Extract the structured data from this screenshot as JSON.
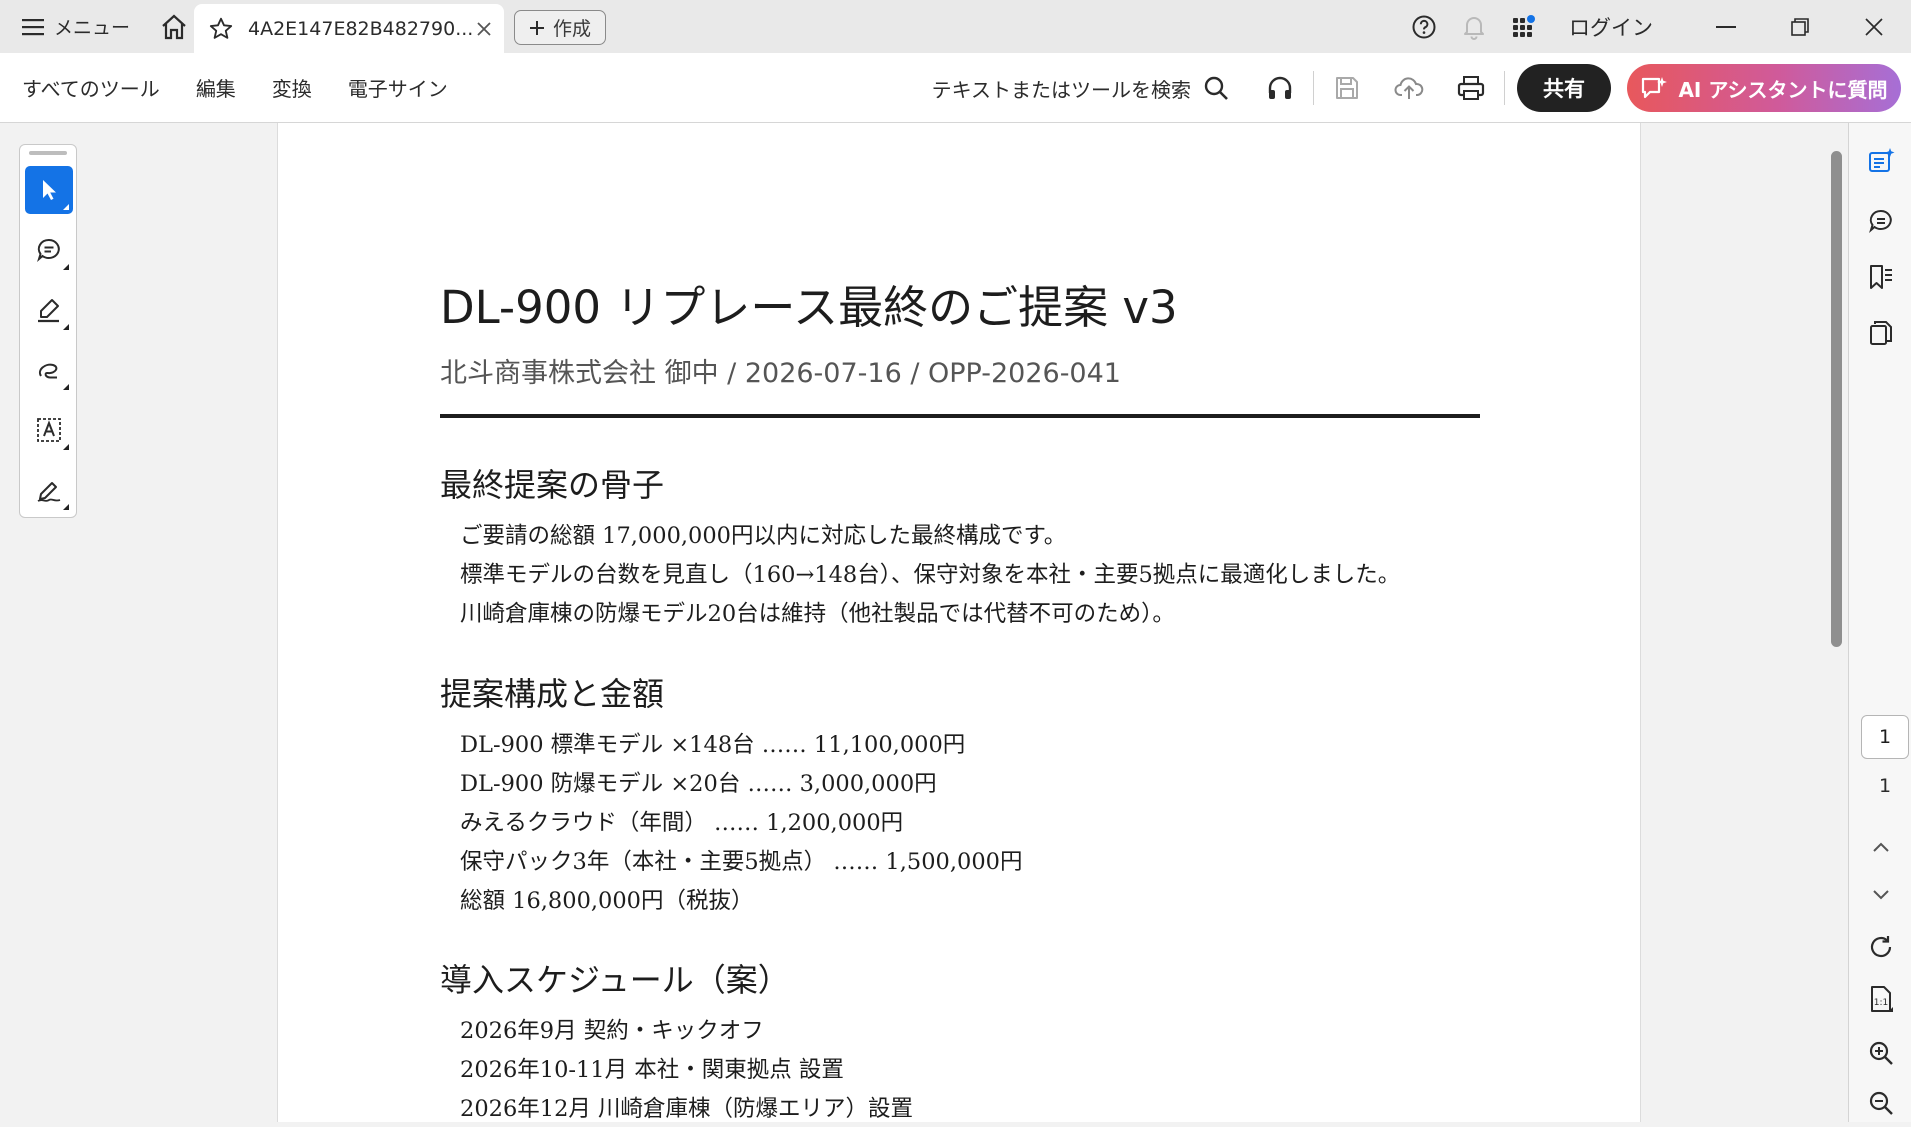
{
  "titlebar": {
    "menu_label": "メニュー",
    "tab_title": "4A2E147E82B482790...",
    "create_label": "作成",
    "login_label": "ログイン"
  },
  "toolbar": {
    "nav": [
      "すべてのツール",
      "編集",
      "変換",
      "電子サイン"
    ],
    "search_label": "テキストまたはツールを検索",
    "share_label": "共有",
    "ai_label": "AI アシスタントに質問"
  },
  "document": {
    "title": "DL-900 リプレース最終のご提案 v3",
    "subtitle": "北斗商事株式会社 御中 / 2026-07-16 / OPP-2026-041",
    "sections": [
      {
        "heading": "最終提案の骨子",
        "lines": [
          "ご要請の総額 17,000,000円以内に対応した最終構成です。",
          "標準モデルの台数を見直し（160→148台）、保守対象を本社・主要5拠点に最適化しました。",
          "川崎倉庫棟の防爆モデル20台は維持（他社製品では代替不可のため）。"
        ]
      },
      {
        "heading": "提案構成と金額",
        "lines": [
          "DL-900 標準モデル ×148台 …… 11,100,000円",
          "DL-900 防爆モデル ×20台 …… 3,000,000円",
          "みえるクラウド（年間） …… 1,200,000円",
          "保守パック3年（本社・主要5拠点） …… 1,500,000円",
          "総額 16,800,000円（税抜）"
        ]
      },
      {
        "heading": "導入スケジュール（案）",
        "lines": [
          "2026年9月 契約・キックオフ",
          "2026年10-11月 本社・関東拠点 設置",
          "2026年12月 川崎倉庫棟（防爆エリア）設置"
        ]
      }
    ]
  },
  "pager": {
    "current": "1",
    "total": "1"
  },
  "colors": {
    "accent": "#1473e6",
    "ai_gradient_start": "#e8585c",
    "ai_gradient_end": "#a66fd6",
    "share_bg": "#222222"
  }
}
